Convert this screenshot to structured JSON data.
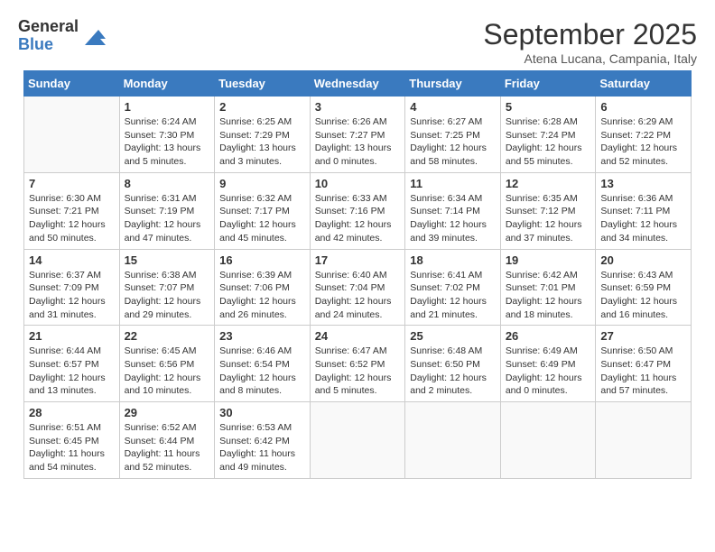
{
  "logo": {
    "general": "General",
    "blue": "Blue"
  },
  "header": {
    "month": "September 2025",
    "location": "Atena Lucana, Campania, Italy"
  },
  "weekdays": [
    "Sunday",
    "Monday",
    "Tuesday",
    "Wednesday",
    "Thursday",
    "Friday",
    "Saturday"
  ],
  "weeks": [
    [
      {
        "day": "",
        "info": ""
      },
      {
        "day": "1",
        "info": "Sunrise: 6:24 AM\nSunset: 7:30 PM\nDaylight: 13 hours\nand 5 minutes."
      },
      {
        "day": "2",
        "info": "Sunrise: 6:25 AM\nSunset: 7:29 PM\nDaylight: 13 hours\nand 3 minutes."
      },
      {
        "day": "3",
        "info": "Sunrise: 6:26 AM\nSunset: 7:27 PM\nDaylight: 13 hours\nand 0 minutes."
      },
      {
        "day": "4",
        "info": "Sunrise: 6:27 AM\nSunset: 7:25 PM\nDaylight: 12 hours\nand 58 minutes."
      },
      {
        "day": "5",
        "info": "Sunrise: 6:28 AM\nSunset: 7:24 PM\nDaylight: 12 hours\nand 55 minutes."
      },
      {
        "day": "6",
        "info": "Sunrise: 6:29 AM\nSunset: 7:22 PM\nDaylight: 12 hours\nand 52 minutes."
      }
    ],
    [
      {
        "day": "7",
        "info": "Sunrise: 6:30 AM\nSunset: 7:21 PM\nDaylight: 12 hours\nand 50 minutes."
      },
      {
        "day": "8",
        "info": "Sunrise: 6:31 AM\nSunset: 7:19 PM\nDaylight: 12 hours\nand 47 minutes."
      },
      {
        "day": "9",
        "info": "Sunrise: 6:32 AM\nSunset: 7:17 PM\nDaylight: 12 hours\nand 45 minutes."
      },
      {
        "day": "10",
        "info": "Sunrise: 6:33 AM\nSunset: 7:16 PM\nDaylight: 12 hours\nand 42 minutes."
      },
      {
        "day": "11",
        "info": "Sunrise: 6:34 AM\nSunset: 7:14 PM\nDaylight: 12 hours\nand 39 minutes."
      },
      {
        "day": "12",
        "info": "Sunrise: 6:35 AM\nSunset: 7:12 PM\nDaylight: 12 hours\nand 37 minutes."
      },
      {
        "day": "13",
        "info": "Sunrise: 6:36 AM\nSunset: 7:11 PM\nDaylight: 12 hours\nand 34 minutes."
      }
    ],
    [
      {
        "day": "14",
        "info": "Sunrise: 6:37 AM\nSunset: 7:09 PM\nDaylight: 12 hours\nand 31 minutes."
      },
      {
        "day": "15",
        "info": "Sunrise: 6:38 AM\nSunset: 7:07 PM\nDaylight: 12 hours\nand 29 minutes."
      },
      {
        "day": "16",
        "info": "Sunrise: 6:39 AM\nSunset: 7:06 PM\nDaylight: 12 hours\nand 26 minutes."
      },
      {
        "day": "17",
        "info": "Sunrise: 6:40 AM\nSunset: 7:04 PM\nDaylight: 12 hours\nand 24 minutes."
      },
      {
        "day": "18",
        "info": "Sunrise: 6:41 AM\nSunset: 7:02 PM\nDaylight: 12 hours\nand 21 minutes."
      },
      {
        "day": "19",
        "info": "Sunrise: 6:42 AM\nSunset: 7:01 PM\nDaylight: 12 hours\nand 18 minutes."
      },
      {
        "day": "20",
        "info": "Sunrise: 6:43 AM\nSunset: 6:59 PM\nDaylight: 12 hours\nand 16 minutes."
      }
    ],
    [
      {
        "day": "21",
        "info": "Sunrise: 6:44 AM\nSunset: 6:57 PM\nDaylight: 12 hours\nand 13 minutes."
      },
      {
        "day": "22",
        "info": "Sunrise: 6:45 AM\nSunset: 6:56 PM\nDaylight: 12 hours\nand 10 minutes."
      },
      {
        "day": "23",
        "info": "Sunrise: 6:46 AM\nSunset: 6:54 PM\nDaylight: 12 hours\nand 8 minutes."
      },
      {
        "day": "24",
        "info": "Sunrise: 6:47 AM\nSunset: 6:52 PM\nDaylight: 12 hours\nand 5 minutes."
      },
      {
        "day": "25",
        "info": "Sunrise: 6:48 AM\nSunset: 6:50 PM\nDaylight: 12 hours\nand 2 minutes."
      },
      {
        "day": "26",
        "info": "Sunrise: 6:49 AM\nSunset: 6:49 PM\nDaylight: 12 hours\nand 0 minutes."
      },
      {
        "day": "27",
        "info": "Sunrise: 6:50 AM\nSunset: 6:47 PM\nDaylight: 11 hours\nand 57 minutes."
      }
    ],
    [
      {
        "day": "28",
        "info": "Sunrise: 6:51 AM\nSunset: 6:45 PM\nDaylight: 11 hours\nand 54 minutes."
      },
      {
        "day": "29",
        "info": "Sunrise: 6:52 AM\nSunset: 6:44 PM\nDaylight: 11 hours\nand 52 minutes."
      },
      {
        "day": "30",
        "info": "Sunrise: 6:53 AM\nSunset: 6:42 PM\nDaylight: 11 hours\nand 49 minutes."
      },
      {
        "day": "",
        "info": ""
      },
      {
        "day": "",
        "info": ""
      },
      {
        "day": "",
        "info": ""
      },
      {
        "day": "",
        "info": ""
      }
    ]
  ]
}
